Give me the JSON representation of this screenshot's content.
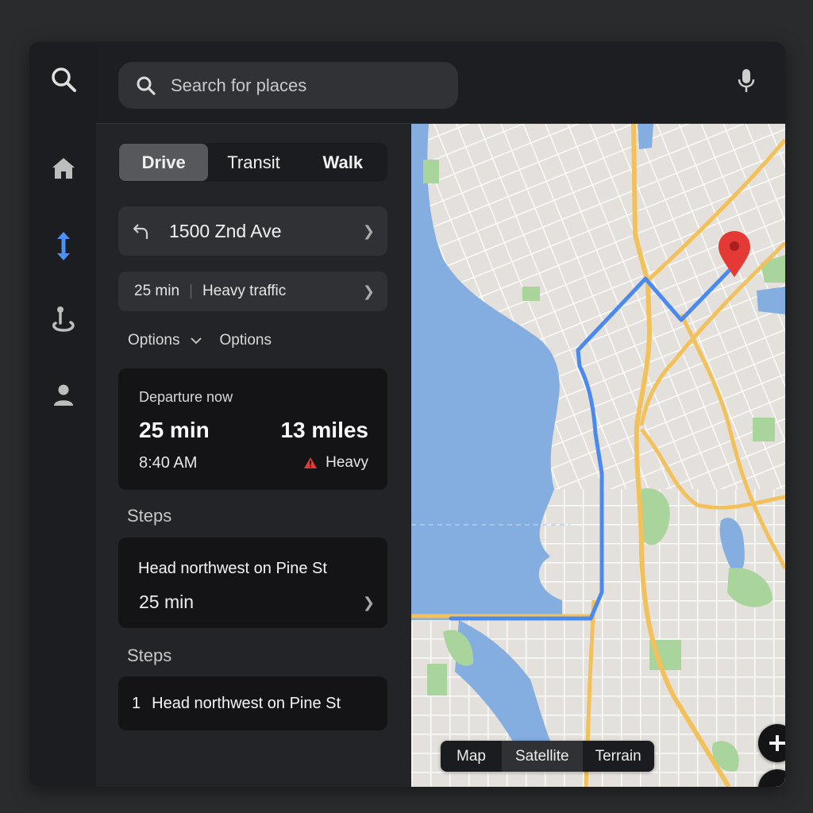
{
  "search": {
    "placeholder": "Search for places"
  },
  "modes": {
    "drive": "Drive",
    "transit": "Transit",
    "walk": "Walk",
    "active": "drive"
  },
  "destination": {
    "address": "1500 Znd Ave"
  },
  "traffic_summary": {
    "duration": "25 min",
    "status": "Heavy traffic"
  },
  "options": {
    "first": "Options",
    "second": "Options"
  },
  "departure": {
    "label": "Departure now",
    "duration": "25 min",
    "distance": "13 miles",
    "arrival_time": "8:40 AM",
    "traffic": "Heavy"
  },
  "steps_section_1": "Steps",
  "step_summary": {
    "instruction": "Head northwest on Pine St",
    "duration": "25 min"
  },
  "steps_section_2": "Steps",
  "step_list": [
    {
      "number": "1",
      "instruction": "Head northwest on Pine St"
    }
  ],
  "map_types": {
    "map": "Map",
    "satellite": "Satellite",
    "terrain": "Terrain",
    "active": "satellite"
  },
  "colors": {
    "accent_blue": "#4c8ff5",
    "route": "#4a8af0",
    "water": "#84aee0",
    "highway": "#f2c15c",
    "park": "#a9d49c",
    "pin": "#e53935",
    "warning": "#e53935"
  },
  "icons": {
    "rail": [
      "search-icon",
      "home-icon",
      "directions-icon",
      "explore-icon",
      "person-icon"
    ],
    "top": [
      "search-icon",
      "mic-icon"
    ],
    "map": [
      "pin-icon",
      "zoom-in-icon",
      "zoom-out-icon"
    ]
  }
}
